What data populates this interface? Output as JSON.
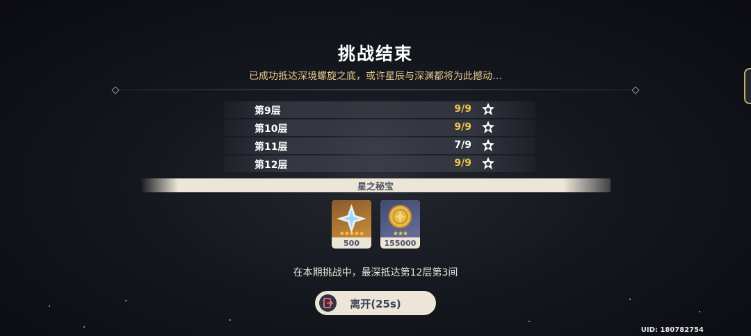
{
  "title": "挑战结束",
  "subtitle": "已成功抵达深境螺旋之底，或许星辰与深渊都将为此撼动…",
  "floors": [
    {
      "name": "第9层",
      "score": "9/9"
    },
    {
      "name": "第10层",
      "score": "9/9"
    },
    {
      "name": "第11层",
      "score": "7/9"
    },
    {
      "name": "第12层",
      "score": "9/9"
    }
  ],
  "reward_header": "星之秘宝",
  "rewards": [
    {
      "icon": "primogem-icon",
      "rarity": "★★★★★",
      "count": "500",
      "color": "#c98c3a"
    },
    {
      "icon": "mora-icon",
      "rarity": "★★★",
      "count": "155000",
      "color": "#6a6e9a"
    }
  ],
  "summary": "在本期挑战中，最深抵达第12层第3间",
  "leave_label": "离开(25s)",
  "uid": "UID: 180782754",
  "colors": {
    "accent_gold": "#f3c44c",
    "panel_cream": "#ece5d8",
    "subtitle": "#e6c98a"
  }
}
